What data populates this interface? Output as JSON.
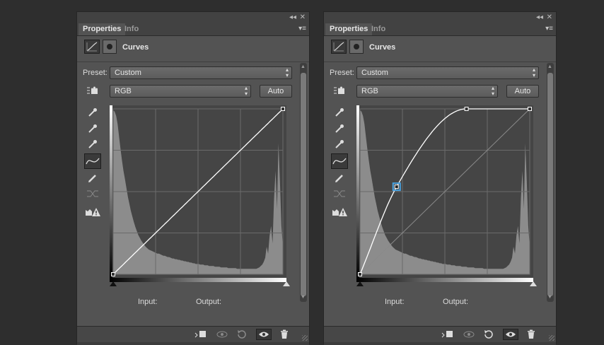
{
  "panels": [
    {
      "tabs": [
        "Properties",
        "Info"
      ],
      "active_tab": "Properties",
      "window_controls": [
        "◂◂",
        "✕"
      ],
      "menu_icon": "▾≡",
      "adjustment_title": "Curves",
      "preset_label": "Preset:",
      "preset_value": "Custom",
      "channel_value": "RGB",
      "auto_label": "Auto",
      "input_label": "Input:",
      "output_label": "Output:",
      "curve_points": [
        [
          0,
          0
        ],
        [
          255,
          255
        ]
      ],
      "selected_point": null
    },
    {
      "tabs": [
        "Properties",
        "Info"
      ],
      "active_tab": "Properties",
      "window_controls": [
        "◂◂",
        "✕"
      ],
      "menu_icon": "▾≡",
      "adjustment_title": "Curves",
      "preset_label": "Preset:",
      "preset_value": "Custom",
      "channel_value": "RGB",
      "auto_label": "Auto",
      "input_label": "Input:",
      "output_label": "Output:",
      "curve_points": [
        [
          0,
          0
        ],
        [
          55,
          135
        ],
        [
          160,
          255
        ],
        [
          255,
          255
        ]
      ],
      "selected_point": [
        55,
        135
      ]
    }
  ],
  "histogram": {
    "levels": [
      238,
      236,
      230,
      218,
      200,
      182,
      165,
      150,
      138,
      125,
      112,
      102,
      92,
      84,
      76,
      69,
      63,
      57,
      53,
      49,
      46,
      43,
      40,
      38,
      36,
      35,
      34,
      33,
      32,
      31,
      30,
      30,
      29,
      28,
      27,
      27,
      26,
      25,
      25,
      24,
      23,
      23,
      22,
      22,
      21,
      21,
      20,
      20,
      19,
      19,
      18,
      18,
      17,
      17,
      16,
      16,
      15,
      15,
      15,
      14,
      14,
      14,
      13,
      13,
      13,
      12,
      12,
      12,
      12,
      11,
      11,
      11,
      11,
      10,
      10,
      10,
      10,
      10,
      9,
      9,
      9,
      9,
      9,
      9,
      8,
      8,
      8,
      8,
      8,
      8,
      8,
      8,
      8,
      8,
      8,
      8,
      8,
      8,
      9,
      10,
      12,
      14,
      18,
      24,
      40,
      30,
      56,
      70,
      45,
      110,
      150,
      95,
      190,
      135,
      70,
      40
    ]
  },
  "icons": {
    "adjustment": "curves-adjustment-icon",
    "mask": "layer-mask-icon",
    "tools": [
      "on-image-adjust-icon",
      "sample-black-point-icon",
      "sample-gray-point-icon",
      "sample-white-point-icon",
      "curve-points-icon",
      "pencil-draw-icon",
      "smooth-curve-icon",
      "clipping-warning-icon"
    ],
    "footer": [
      "clip-to-layer-icon",
      "view-previous-state-icon",
      "reset-icon",
      "toggle-visibility-icon",
      "delete-layer-icon"
    ]
  },
  "colors": {
    "panel_bg": "#535353",
    "graph_bg": "#454545",
    "histogram": "#8c8c8c",
    "curve": "#ffffff",
    "selected_point": "#4aa3e0"
  }
}
